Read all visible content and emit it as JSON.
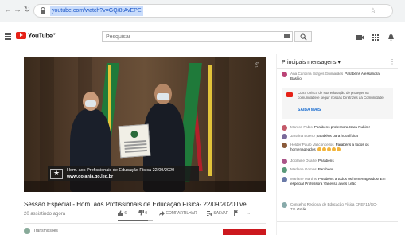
{
  "browser": {
    "url": "youtube.com/watch?v=GQ/8tAvEPE"
  },
  "header": {
    "logo_text": "YouTube",
    "logo_sup": "BR",
    "search_placeholder": "Pesquisar"
  },
  "video": {
    "corner_logo": "ℰ",
    "lower_third": {
      "line1": "Hom. aos Profissionais de Educação Física 22/09/2020",
      "line2": "www.goiania.go.leg.br"
    },
    "title": "Sessão Especial - Hom. aos Profissionais de Educação Física- 22/09/2020 live",
    "views": "20 assistindo agora",
    "likes": "6",
    "dislikes": "0",
    "share_label": "COMPARTILHAR",
    "save_label": "SALVAR",
    "more_label": "..."
  },
  "channel": {
    "name": "Transmissões"
  },
  "chat": {
    "header": "Principais mensagens",
    "first": {
      "author": "Ana Carolina Borges Guimarães",
      "text": "Parabéns Alessandra Basílio"
    },
    "promo": {
      "text": "Corra o risco de sua educação de proteger na comunidade e seguir nossas Diretrizes da Comunidade.",
      "link": "SAIBA MAIS"
    },
    "messages": [
      {
        "author": "Marcos Fabio",
        "text": "Parabéns professora Isara Rubim!",
        "color": "#c45a6a"
      },
      {
        "author": "Janaina Bueno",
        "text": "parabéns para hora física",
        "color": "#7a6a9a"
      },
      {
        "author": "Helder Paulo Vasconcellos",
        "text": "Parabéns a todos os homenageados",
        "color": "#8a5a3a"
      },
      {
        "author": "Jocilaine Duarte",
        "text": "Parabéns",
        "color": "#a58"
      },
      {
        "author": "Marlene Gomes",
        "text": "Parabéns",
        "color": "#5a9a7a"
      },
      {
        "author": "Mariane Martins",
        "text": "Parabéns a todos os homenageados! Em especial Professora Vanessa alves Leão",
        "color": "#6a7aa8"
      },
      {
        "author": "Conselho Regional de Educação Física CREF14/GO-TO",
        "text": "Goiás",
        "color": "#8aa"
      }
    ]
  }
}
